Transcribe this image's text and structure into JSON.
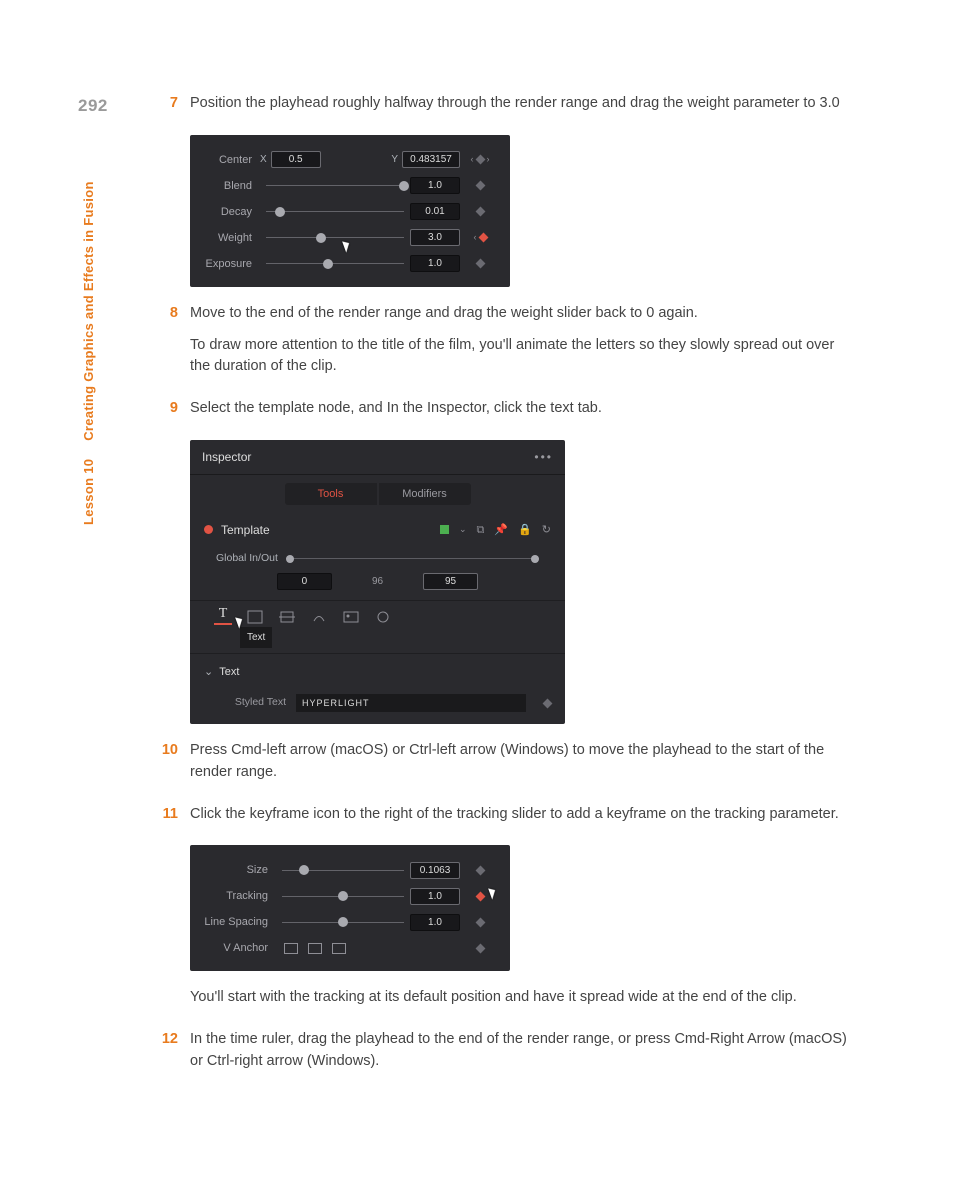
{
  "page_number": "292",
  "marginal_lesson": "Lesson 10",
  "marginal_title": "Creating Graphics and Effects in Fusion",
  "steps": {
    "s7": {
      "num": "7",
      "text": "Position the playhead roughly halfway through the render range and drag the weight parameter to 3.0"
    },
    "s8": {
      "num": "8",
      "text1": "Move to the end of the render range and drag the weight slider back to 0 again.",
      "text2": "To draw more attention to the title of the film, you'll animate the letters so they slowly spread out over the duration of the clip."
    },
    "s9": {
      "num": "9",
      "text": "Select the template node, and In the Inspector, click the text tab."
    },
    "s10": {
      "num": "10",
      "text": "Press Cmd-left arrow (macOS) or Ctrl-left arrow (Windows) to move the playhead to the start of the render range."
    },
    "s11": {
      "num": "11",
      "text": "Click the keyframe icon to the right of the tracking slider to add a keyframe on the tracking parameter."
    },
    "s11b": "You'll start with the tracking at its default position and have it spread wide at the end of the clip.",
    "s12": {
      "num": "12",
      "text": "In the time ruler, drag the playhead to the end of the render range, or press Cmd-Right Arrow (macOS) or Ctrl-right arrow (Windows)."
    }
  },
  "panel1": {
    "center_label": "Center",
    "center_x_label": "X",
    "center_x": "0.5",
    "center_y_label": "Y",
    "center_y": "0.483157",
    "blend_label": "Blend",
    "blend": "1.0",
    "decay_label": "Decay",
    "decay": "0.01",
    "weight_label": "Weight",
    "weight": "3.0",
    "exposure_label": "Exposure",
    "exposure": "1.0"
  },
  "panel2": {
    "title": "Inspector",
    "tab_tools": "Tools",
    "tab_modifiers": "Modifiers",
    "template": "Template",
    "global_label": "Global In/Out",
    "range_in": "0",
    "range_mid": "96",
    "range_out": "95",
    "tooltip": "Text",
    "text_section": "Text",
    "styled_label": "Styled Text",
    "styled_value": "HYPERLIGHT"
  },
  "panel3": {
    "size_label": "Size",
    "size": "0.1063",
    "tracking_label": "Tracking",
    "tracking": "1.0",
    "linespacing_label": "Line Spacing",
    "linespacing": "1.0",
    "vanchor_label": "V Anchor"
  }
}
